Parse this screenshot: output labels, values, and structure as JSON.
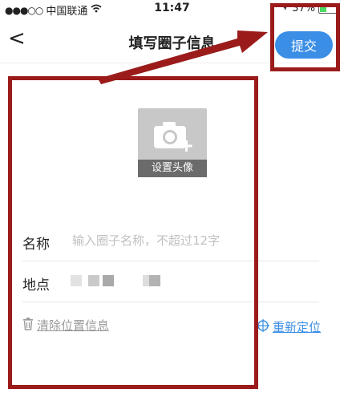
{
  "status_bar": {
    "signal": "●●●○○",
    "carrier": "中国联通",
    "time": "11:47",
    "battery": "37%",
    "battery_level": 0.37
  },
  "nav": {
    "back_label": "<",
    "title": "填写圈子信息",
    "submit_label": "提交"
  },
  "avatar": {
    "caption": "设置头像"
  },
  "form": {
    "name_label": "名称",
    "name_placeholder": "输入圈子名称，不超过12字",
    "location_label": "地点"
  },
  "actions": {
    "clear_location": "清除位置信息",
    "relocate": "重新定位"
  },
  "colors": {
    "accent": "#3a8ee6",
    "annotation": "#9b1b1b"
  }
}
